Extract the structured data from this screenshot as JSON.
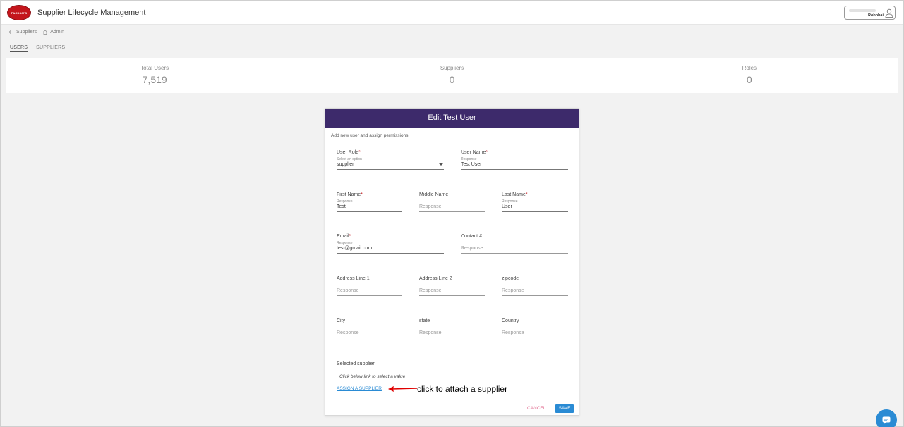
{
  "header": {
    "logo_text": "PACKAM'S",
    "title": "Supplier Lifecycle Management",
    "user_name": "Robobai"
  },
  "breadcrumb": {
    "back_label": "Suppliers",
    "home_label": "Admin"
  },
  "tabs": [
    {
      "label": "USERS",
      "active": true
    },
    {
      "label": "SUPPLIERS",
      "active": false
    }
  ],
  "stats": [
    {
      "label": "Total Users",
      "value": "7,519"
    },
    {
      "label": "Suppliers",
      "value": "0"
    },
    {
      "label": "Roles",
      "value": "0"
    }
  ],
  "dialog": {
    "title": "Edit Test User",
    "subtitle": "Add new user and assign permissions",
    "user_role": {
      "label": "User Role",
      "required": "*",
      "hint": "Select an option",
      "value": "supplier"
    },
    "user_name": {
      "label": "User Name",
      "required": "*",
      "hint": "Response",
      "value": "Test User"
    },
    "first_name": {
      "label": "First Name",
      "required": "*",
      "hint": "Response",
      "value": "Test"
    },
    "middle_name": {
      "label": "Middle Name",
      "placeholder": "Response"
    },
    "last_name": {
      "label": "Last Name",
      "required": "*",
      "hint": "Response",
      "value": "User"
    },
    "email": {
      "label": "Email",
      "required": "*",
      "hint": "Response",
      "value": "test@gmail.com"
    },
    "contact": {
      "label": "Contact #",
      "placeholder": "Response"
    },
    "address1": {
      "label": "Address Line 1",
      "placeholder": "Response"
    },
    "address2": {
      "label": "Address Line 2",
      "placeholder": "Response"
    },
    "zipcode": {
      "label": "zipcode",
      "placeholder": "Response"
    },
    "city": {
      "label": "City",
      "placeholder": "Response"
    },
    "state": {
      "label": "state",
      "placeholder": "Response"
    },
    "country": {
      "label": "Country",
      "placeholder": "Response"
    },
    "selected_supplier_label": "Selected supplier",
    "selected_supplier_hint": "Click below link to select a value",
    "assign_link": "ASSIGN A SUPPLIER",
    "cancel_label": "CANCEL",
    "save_label": "SAVE"
  },
  "annotation": {
    "text": "click to attach a supplier",
    "color": "#e00000"
  },
  "colors": {
    "header_purple": "#3d2a6b",
    "primary_blue": "#2a8bd4",
    "brand_red": "#c4161c"
  }
}
